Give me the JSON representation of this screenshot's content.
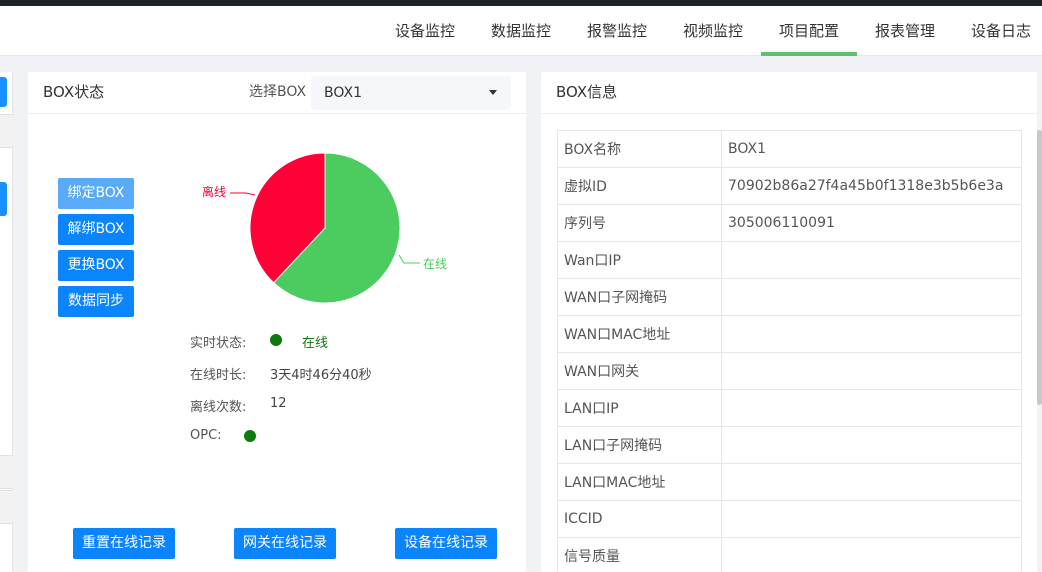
{
  "nav": {
    "items": [
      {
        "label": "设备监控",
        "active": false
      },
      {
        "label": "数据监控",
        "active": false
      },
      {
        "label": "报警监控",
        "active": false
      },
      {
        "label": "视频监控",
        "active": false
      },
      {
        "label": "项目配置",
        "active": true
      },
      {
        "label": "报表管理",
        "active": false
      },
      {
        "label": "设备日志",
        "active": false
      }
    ]
  },
  "box_status": {
    "title": "BOX状态",
    "select_label": "选择BOX",
    "selected_box": "BOX1",
    "actions": [
      "绑定BOX",
      "解绑BOX",
      "更换BOX",
      "数据同步"
    ],
    "chart_data": {
      "type": "pie",
      "slices": [
        {
          "label": "离线",
          "value": 38,
          "color": "#ff0037"
        },
        {
          "label": "在线",
          "value": 62,
          "color": "#4ccc5f"
        }
      ]
    },
    "status": {
      "realtime_label": "实时状态:",
      "realtime_value": "在线",
      "online_time_label": "在线时长:",
      "online_time_value": "3天4时46分40秒",
      "offline_count_label": "离线次数:",
      "offline_count_value": "12",
      "opc_label": "OPC:"
    },
    "bottom_buttons": [
      "重置在线记录",
      "网关在线记录",
      "设备在线记录"
    ],
    "colors": {
      "online_dot": "#0d7a0d",
      "online_text": "#0d7a0d"
    }
  },
  "box_info": {
    "title": "BOX信息",
    "rows": [
      {
        "key": "BOX名称",
        "value": "BOX1"
      },
      {
        "key": "虚拟ID",
        "value": "70902b86a27f4a45b0f1318e3b5b6e3a"
      },
      {
        "key": "序列号",
        "value": "305006110091"
      },
      {
        "key": "Wan口IP",
        "value": ""
      },
      {
        "key": "WAN口子网掩码",
        "value": ""
      },
      {
        "key": "WAN口MAC地址",
        "value": ""
      },
      {
        "key": "WAN口网关",
        "value": ""
      },
      {
        "key": "LAN口IP",
        "value": ""
      },
      {
        "key": "LAN口子网掩码",
        "value": ""
      },
      {
        "key": "LAN口MAC地址",
        "value": ""
      },
      {
        "key": "ICCID",
        "value": ""
      },
      {
        "key": "信号质量",
        "value": ""
      }
    ]
  }
}
